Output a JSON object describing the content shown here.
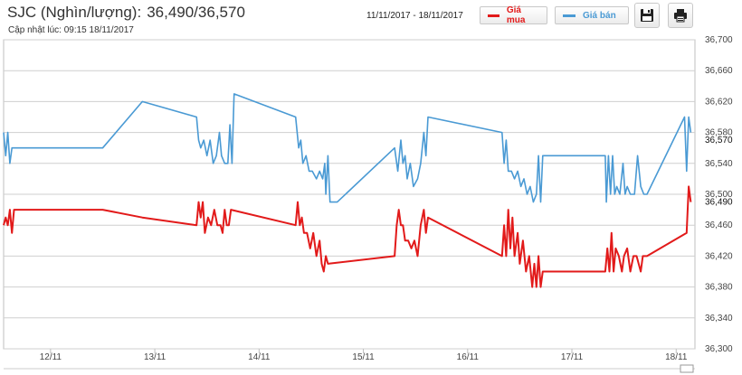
{
  "header": {
    "title": "SJC (Nghìn/lượng):",
    "price": "36,490/36,570",
    "updated": "Cập nhật lúc: 09:15 18/11/2017"
  },
  "toolbar": {
    "date_range": "11/11/2017 - 18/11/2017",
    "legend_buy": "Giá mua",
    "legend_sell": "Giá bán",
    "save_icon": "floppy-disk-icon",
    "print_icon": "printer-icon"
  },
  "colors": {
    "buy": "#e21a1a",
    "sell": "#4a9ad4",
    "grid": "#cfcfcf"
  },
  "chart_data": {
    "type": "line",
    "x_ticks": [
      "12/11",
      "13/11",
      "14/11",
      "15/11",
      "16/11",
      "17/11",
      "18/11"
    ],
    "y_ticks": [
      "36,300",
      "36,340",
      "36,380",
      "36,420",
      "36,460",
      "36,500",
      "36,540",
      "36,580",
      "36,620",
      "36,660",
      "36,700"
    ],
    "ylim": [
      36300,
      36700
    ],
    "xlim": [
      11.55,
      18.18
    ],
    "grid": true,
    "end_labels": [
      "36,570",
      "36,490"
    ],
    "series": [
      {
        "name": "Giá bán",
        "color": "#4a9ad4",
        "points": [
          [
            11.55,
            36580
          ],
          [
            11.57,
            36550
          ],
          [
            11.59,
            36580
          ],
          [
            11.61,
            36540
          ],
          [
            11.63,
            36560
          ],
          [
            11.65,
            36560
          ],
          [
            12.5,
            36560
          ],
          [
            12.88,
            36620
          ],
          [
            13.4,
            36600
          ],
          [
            13.42,
            36570
          ],
          [
            13.44,
            36560
          ],
          [
            13.47,
            36570
          ],
          [
            13.5,
            36550
          ],
          [
            13.53,
            36570
          ],
          [
            13.56,
            36540
          ],
          [
            13.59,
            36550
          ],
          [
            13.62,
            36580
          ],
          [
            13.64,
            36550
          ],
          [
            13.67,
            36540
          ],
          [
            13.7,
            36540
          ],
          [
            13.72,
            36590
          ],
          [
            13.74,
            36540
          ],
          [
            13.76,
            36630
          ],
          [
            14.35,
            36600
          ],
          [
            14.38,
            36560
          ],
          [
            14.4,
            36570
          ],
          [
            14.42,
            36540
          ],
          [
            14.45,
            36550
          ],
          [
            14.48,
            36530
          ],
          [
            14.51,
            36530
          ],
          [
            14.55,
            36520
          ],
          [
            14.58,
            36530
          ],
          [
            14.61,
            36520
          ],
          [
            14.63,
            36540
          ],
          [
            14.64,
            36500
          ],
          [
            14.66,
            36550
          ],
          [
            14.68,
            36490
          ],
          [
            14.75,
            36490
          ],
          [
            15.3,
            36560
          ],
          [
            15.33,
            36530
          ],
          [
            15.36,
            36570
          ],
          [
            15.38,
            36540
          ],
          [
            15.4,
            36550
          ],
          [
            15.42,
            36520
          ],
          [
            15.45,
            36540
          ],
          [
            15.48,
            36510
          ],
          [
            15.52,
            36520
          ],
          [
            15.55,
            36540
          ],
          [
            15.58,
            36580
          ],
          [
            15.6,
            36550
          ],
          [
            15.62,
            36600
          ],
          [
            16.33,
            36580
          ],
          [
            16.35,
            36540
          ],
          [
            16.37,
            36570
          ],
          [
            16.39,
            36530
          ],
          [
            16.42,
            36530
          ],
          [
            16.45,
            36520
          ],
          [
            16.48,
            36530
          ],
          [
            16.51,
            36510
          ],
          [
            16.54,
            36520
          ],
          [
            16.57,
            36500
          ],
          [
            16.6,
            36510
          ],
          [
            16.63,
            36490
          ],
          [
            16.66,
            36500
          ],
          [
            16.68,
            36550
          ],
          [
            16.7,
            36490
          ],
          [
            16.72,
            36550
          ],
          [
            17.32,
            36550
          ],
          [
            17.33,
            36490
          ],
          [
            17.35,
            36550
          ],
          [
            17.37,
            36500
          ],
          [
            17.39,
            36550
          ],
          [
            17.41,
            36500
          ],
          [
            17.43,
            36510
          ],
          [
            17.46,
            36500
          ],
          [
            17.49,
            36540
          ],
          [
            17.51,
            36500
          ],
          [
            17.53,
            36510
          ],
          [
            17.56,
            36500
          ],
          [
            17.6,
            36500
          ],
          [
            17.63,
            36550
          ],
          [
            17.66,
            36510
          ],
          [
            17.69,
            36500
          ],
          [
            17.72,
            36500
          ],
          [
            18.08,
            36600
          ],
          [
            18.1,
            36530
          ],
          [
            18.12,
            36600
          ],
          [
            18.14,
            36580
          ]
        ]
      },
      {
        "name": "Giá mua",
        "color": "#e21a1a",
        "points": [
          [
            11.55,
            36460
          ],
          [
            11.57,
            36470
          ],
          [
            11.59,
            36460
          ],
          [
            11.61,
            36480
          ],
          [
            11.63,
            36450
          ],
          [
            11.65,
            36480
          ],
          [
            12.5,
            36480
          ],
          [
            12.88,
            36470
          ],
          [
            13.4,
            36460
          ],
          [
            13.42,
            36490
          ],
          [
            13.44,
            36470
          ],
          [
            13.46,
            36490
          ],
          [
            13.48,
            36450
          ],
          [
            13.51,
            36470
          ],
          [
            13.54,
            36460
          ],
          [
            13.57,
            36480
          ],
          [
            13.6,
            36460
          ],
          [
            13.63,
            36460
          ],
          [
            13.65,
            36450
          ],
          [
            13.67,
            36480
          ],
          [
            13.69,
            36460
          ],
          [
            13.71,
            36460
          ],
          [
            13.73,
            36480
          ],
          [
            14.35,
            36460
          ],
          [
            14.37,
            36490
          ],
          [
            14.39,
            36460
          ],
          [
            14.41,
            36470
          ],
          [
            14.43,
            36450
          ],
          [
            14.46,
            36450
          ],
          [
            14.49,
            36430
          ],
          [
            14.52,
            36450
          ],
          [
            14.55,
            36420
          ],
          [
            14.58,
            36440
          ],
          [
            14.6,
            36410
          ],
          [
            14.62,
            36400
          ],
          [
            14.64,
            36420
          ],
          [
            14.66,
            36410
          ],
          [
            15.3,
            36420
          ],
          [
            15.32,
            36460
          ],
          [
            15.34,
            36480
          ],
          [
            15.36,
            36460
          ],
          [
            15.38,
            36460
          ],
          [
            15.4,
            36440
          ],
          [
            15.43,
            36440
          ],
          [
            15.46,
            36430
          ],
          [
            15.49,
            36440
          ],
          [
            15.52,
            36420
          ],
          [
            15.55,
            36460
          ],
          [
            15.58,
            36480
          ],
          [
            15.6,
            36450
          ],
          [
            15.62,
            36470
          ],
          [
            16.33,
            36420
          ],
          [
            16.35,
            36460
          ],
          [
            16.37,
            36420
          ],
          [
            16.39,
            36480
          ],
          [
            16.41,
            36430
          ],
          [
            16.43,
            36470
          ],
          [
            16.45,
            36420
          ],
          [
            16.48,
            36450
          ],
          [
            16.5,
            36410
          ],
          [
            16.53,
            36440
          ],
          [
            16.56,
            36400
          ],
          [
            16.59,
            36420
          ],
          [
            16.62,
            36380
          ],
          [
            16.64,
            36410
          ],
          [
            16.66,
            36380
          ],
          [
            16.68,
            36420
          ],
          [
            16.7,
            36380
          ],
          [
            16.72,
            36400
          ],
          [
            17.32,
            36400
          ],
          [
            17.34,
            36430
          ],
          [
            17.36,
            36400
          ],
          [
            17.38,
            36450
          ],
          [
            17.4,
            36400
          ],
          [
            17.42,
            36430
          ],
          [
            17.45,
            36420
          ],
          [
            17.48,
            36400
          ],
          [
            17.5,
            36420
          ],
          [
            17.53,
            36430
          ],
          [
            17.56,
            36400
          ],
          [
            17.59,
            36420
          ],
          [
            17.62,
            36420
          ],
          [
            17.66,
            36400
          ],
          [
            17.68,
            36420
          ],
          [
            17.72,
            36420
          ],
          [
            18.1,
            36450
          ],
          [
            18.12,
            36510
          ],
          [
            18.14,
            36490
          ]
        ]
      }
    ]
  }
}
